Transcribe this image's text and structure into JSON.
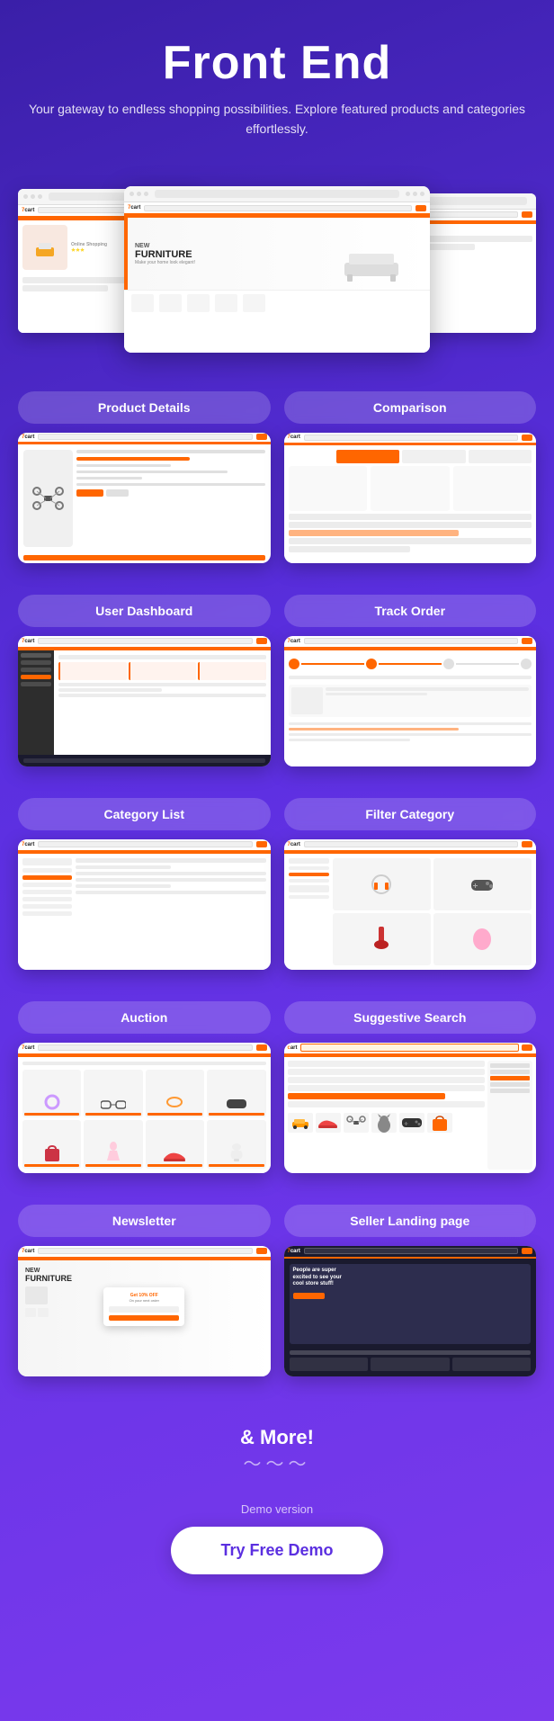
{
  "header": {
    "title": "Front End",
    "subtitle": "Your gateway to endless shopping possibilities. Explore featured products and categories effortlessly."
  },
  "sections": [
    {
      "id": "product-details",
      "label": "Product Details",
      "position": "left"
    },
    {
      "id": "comparison",
      "label": "Comparison",
      "position": "right"
    },
    {
      "id": "user-dashboard",
      "label": "User Dashboard",
      "position": "left"
    },
    {
      "id": "track-order",
      "label": "Track Order",
      "position": "right"
    },
    {
      "id": "category-list",
      "label": "Category List",
      "position": "left"
    },
    {
      "id": "filter-category",
      "label": "Filter Category",
      "position": "right"
    },
    {
      "id": "auction",
      "label": "Auction",
      "position": "left"
    },
    {
      "id": "suggestive-search",
      "label": "Suggestive Search",
      "position": "right"
    },
    {
      "id": "newsletter",
      "label": "Newsletter",
      "position": "left"
    },
    {
      "id": "seller-landing",
      "label": "Seller Landing page",
      "position": "right"
    }
  ],
  "more": {
    "text": "& More!",
    "wave": "~~~"
  },
  "cta": {
    "demo_label": "Demo version",
    "button_label": "Try Free Demo"
  },
  "colors": {
    "accent": "#ff6600",
    "background_start": "#3a1fa8",
    "background_end": "#7c3aed",
    "white": "#ffffff"
  }
}
